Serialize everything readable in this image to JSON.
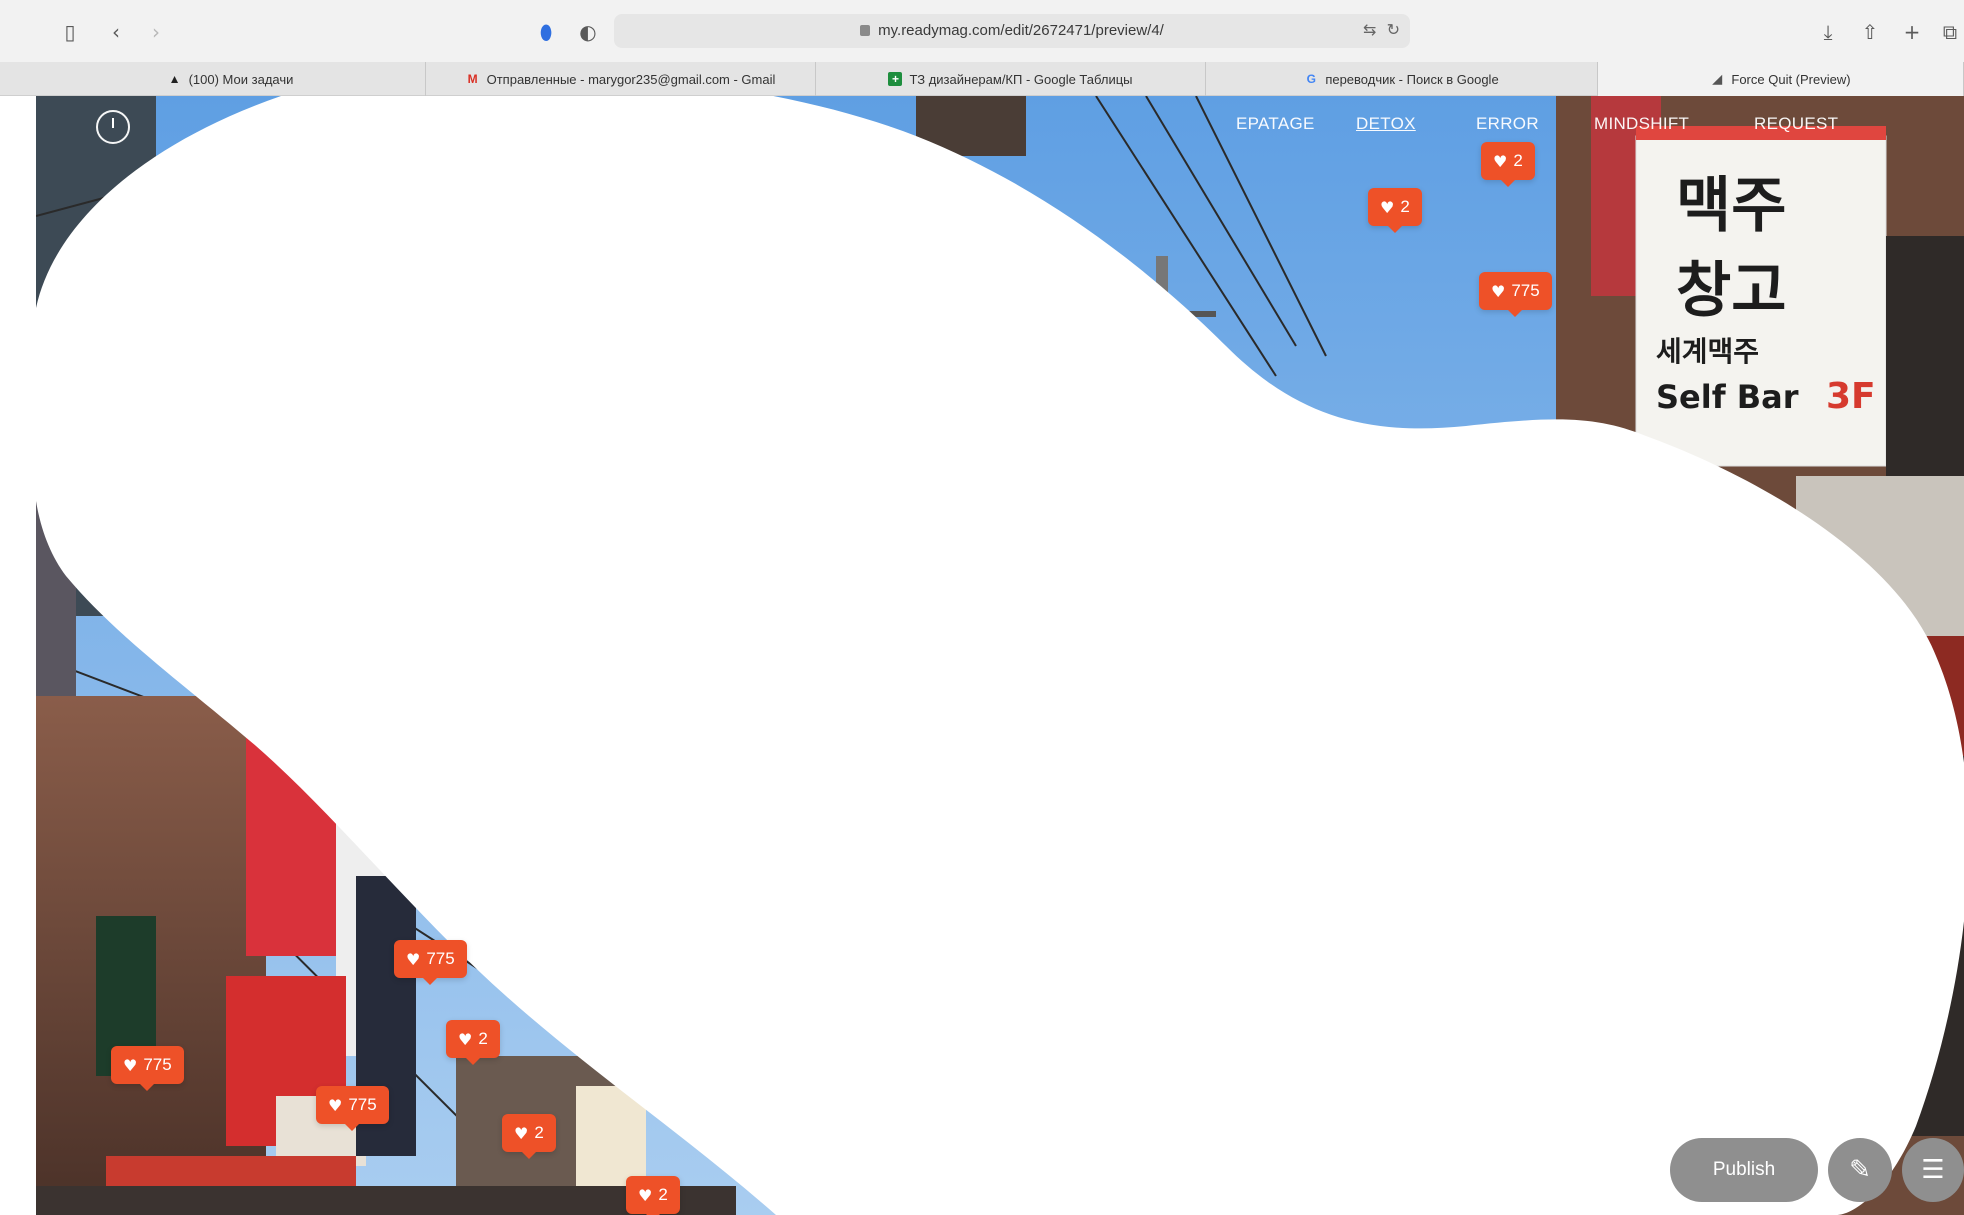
{
  "browser": {
    "url": "my.readymag.com/edit/2672471/preview/4/",
    "tabs": [
      {
        "favicon": "notion-icon",
        "label": "(100) Мои задачи"
      },
      {
        "favicon": "gmail-icon",
        "label": "Отправленные - marygor235@gmail.com - Gmail"
      },
      {
        "favicon": "sheets-icon",
        "label": "ТЗ дизайнерам/КП - Google Таблицы"
      },
      {
        "favicon": "google-icon",
        "label": "переводчик - Поиск в Google"
      },
      {
        "favicon": "feather-icon",
        "label": "Force Quit (Preview)"
      }
    ]
  },
  "nav": {
    "items": [
      {
        "label": "EPATAGE"
      },
      {
        "label": "DETOX"
      },
      {
        "label": "ERROR"
      },
      {
        "label": "MINDSHIFT"
      },
      {
        "label": "REQUEST"
      }
    ],
    "active": "DETOX"
  },
  "badges": [
    {
      "count": "2"
    },
    {
      "count": "2"
    },
    {
      "count": "775"
    },
    {
      "count": "775"
    },
    {
      "count": "2"
    },
    {
      "count": "775"
    },
    {
      "count": "775"
    },
    {
      "count": "2"
    },
    {
      "count": "2"
    }
  ],
  "controls": {
    "publish_label": "Publish",
    "edit_icon": "pencil-icon",
    "menu_icon": "hamburger-icon"
  },
  "photo_signage": {
    "sign_korean_1": "맥주",
    "sign_korean_2": "창고",
    "sign_korean_3": "세계맥주",
    "sign_english": "Self Bar"
  },
  "colors": {
    "badge": "#ee5128",
    "sky": "#7fb3e8",
    "buttons": "#8f8f8f"
  }
}
